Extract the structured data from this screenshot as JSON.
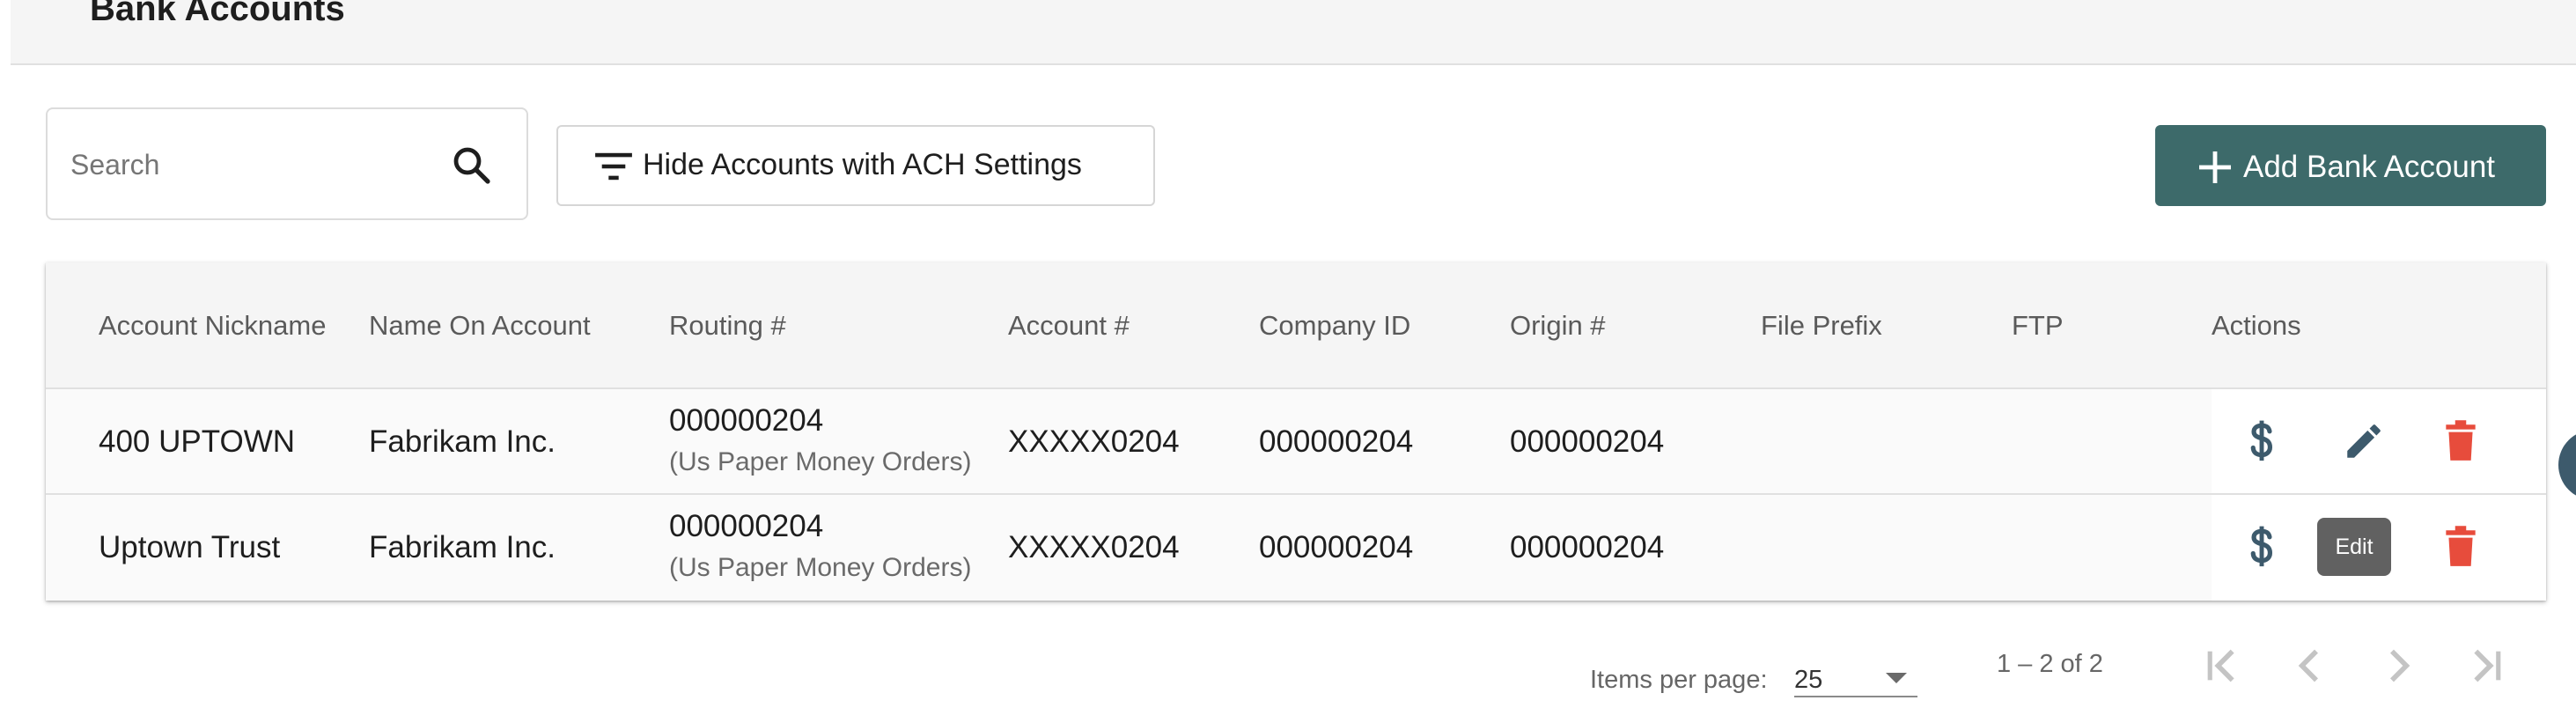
{
  "page": {
    "title": "Bank Accounts"
  },
  "toolbar": {
    "search_placeholder": "Search",
    "filter_label": "Hide Accounts with ACH Settings",
    "add_label": "Add Bank Account"
  },
  "colors": {
    "accent": "#3d6a6a",
    "delete": "#e74c3c",
    "icon": "#3d5a6c",
    "header_bg": "#f5f5f5"
  },
  "table": {
    "columns": [
      "Account Nickname",
      "Name On Account",
      "Routing #",
      "Account #",
      "Company ID",
      "Origin #",
      "File Prefix",
      "FTP",
      "Actions"
    ],
    "rows": [
      {
        "nickname": "400 UPTOWN",
        "name_on_account": "Fabrikam Inc.",
        "routing_number": "000000204",
        "routing_bank": "(Us Paper Money Orders)",
        "account_number": "XXXXX0204",
        "company_id": "000000204",
        "origin": "000000204",
        "file_prefix": "",
        "ftp": ""
      },
      {
        "nickname": "Uptown Trust",
        "name_on_account": "Fabrikam Inc.",
        "routing_number": "000000204",
        "routing_bank": "(Us Paper Money Orders)",
        "account_number": "XXXXX0204",
        "company_id": "000000204",
        "origin": "000000204",
        "file_prefix": "",
        "ftp": ""
      }
    ],
    "actions": [
      "dollar-icon",
      "pencil-icon",
      "trash-icon"
    ]
  },
  "tooltip": {
    "text": "Edit"
  },
  "paginator": {
    "items_per_page_label": "Items per page:",
    "page_size": "25",
    "range_label": "1 – 2 of 2"
  }
}
